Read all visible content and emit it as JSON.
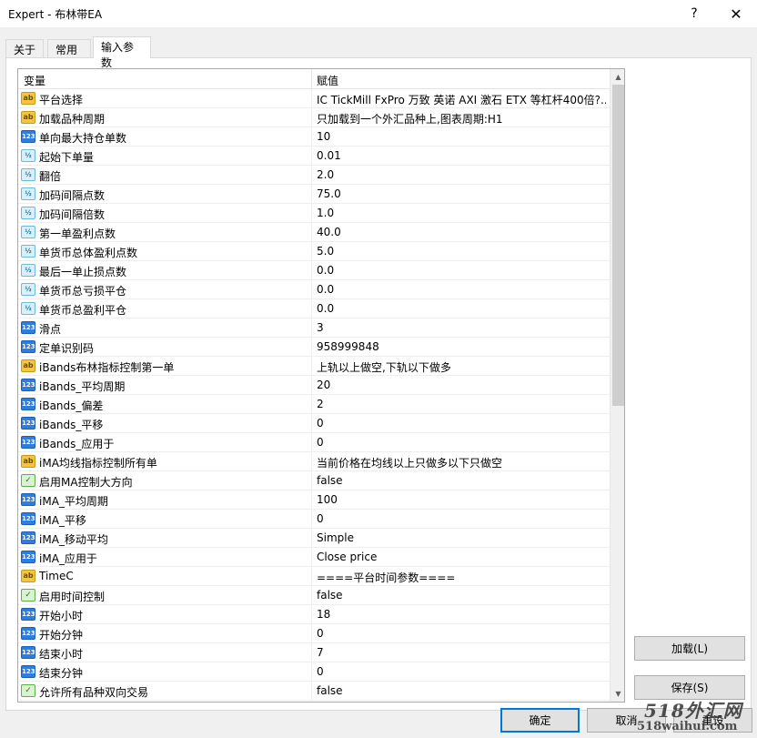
{
  "window": {
    "title": "Expert - 布林带EA",
    "help": "?",
    "close": "✕"
  },
  "tabs": [
    {
      "label": "关于"
    },
    {
      "label": "常用"
    },
    {
      "label": "输入参数"
    }
  ],
  "grid": {
    "col_variable": "变量",
    "col_value": "赋值",
    "rows": [
      {
        "icon": "ab",
        "name": "平台选择",
        "value": "IC TickMill FxPro 万致 英诺 AXI 激石 ETX 等杠杆400倍?.."
      },
      {
        "icon": "ab",
        "name": "加载品种周期",
        "value": "只加载到一个外汇品种上,图表周期:H1"
      },
      {
        "icon": "123",
        "name": "单向最大持仓单数",
        "value": "10"
      },
      {
        "icon": "v12",
        "name": "起始下单量",
        "value": "0.01"
      },
      {
        "icon": "v12",
        "name": "翻倍",
        "value": "2.0"
      },
      {
        "icon": "v12",
        "name": "加码间隔点数",
        "value": "75.0"
      },
      {
        "icon": "v12",
        "name": "加码间隔倍数",
        "value": "1.0"
      },
      {
        "icon": "v12",
        "name": "第一单盈利点数",
        "value": "40.0"
      },
      {
        "icon": "v12",
        "name": "单货币总体盈利点数",
        "value": "5.0"
      },
      {
        "icon": "v12",
        "name": "最后一单止损点数",
        "value": "0.0"
      },
      {
        "icon": "v12",
        "name": "单货币总亏损平仓",
        "value": "0.0"
      },
      {
        "icon": "v12",
        "name": "单货币总盈利平仓",
        "value": "0.0"
      },
      {
        "icon": "123",
        "name": "滑点",
        "value": "3"
      },
      {
        "icon": "123",
        "name": "定单识别码",
        "value": "958999848"
      },
      {
        "icon": "ab",
        "name": "iBands布林指标控制第一单",
        "value": "上轨以上做空,下轨以下做多"
      },
      {
        "icon": "123",
        "name": "iBands_平均周期",
        "value": "20"
      },
      {
        "icon": "123",
        "name": "iBands_偏差",
        "value": "2"
      },
      {
        "icon": "123",
        "name": "iBands_平移",
        "value": "0"
      },
      {
        "icon": "123",
        "name": "iBands_应用于",
        "value": "0"
      },
      {
        "icon": "ab",
        "name": "iMA均线指标控制所有单",
        "value": "当前价格在均线以上只做多以下只做空"
      },
      {
        "icon": "bool",
        "name": "启用MA控制大方向",
        "value": "false"
      },
      {
        "icon": "123",
        "name": "iMA_平均周期",
        "value": "100"
      },
      {
        "icon": "123",
        "name": "iMA_平移",
        "value": "0"
      },
      {
        "icon": "123",
        "name": "iMA_移动平均",
        "value": "Simple"
      },
      {
        "icon": "123",
        "name": "iMA_应用于",
        "value": "Close price"
      },
      {
        "icon": "ab",
        "name": "TimeC",
        "value": "====平台时间参数===="
      },
      {
        "icon": "bool",
        "name": "启用时间控制",
        "value": "false"
      },
      {
        "icon": "123",
        "name": "开始小时",
        "value": "18"
      },
      {
        "icon": "123",
        "name": "开始分钟",
        "value": "0"
      },
      {
        "icon": "123",
        "name": "结束小时",
        "value": "7"
      },
      {
        "icon": "123",
        "name": "结束分钟",
        "value": "0"
      },
      {
        "icon": "bool",
        "name": "允许所有品种双向交易",
        "value": "false"
      }
    ]
  },
  "buttons": {
    "load": "加载(L)",
    "save": "保存(S)",
    "ok": "确定",
    "cancel": "取消",
    "reset": "重设"
  },
  "watermark": {
    "line1": "518外汇网",
    "line2": "518waihui.com"
  }
}
